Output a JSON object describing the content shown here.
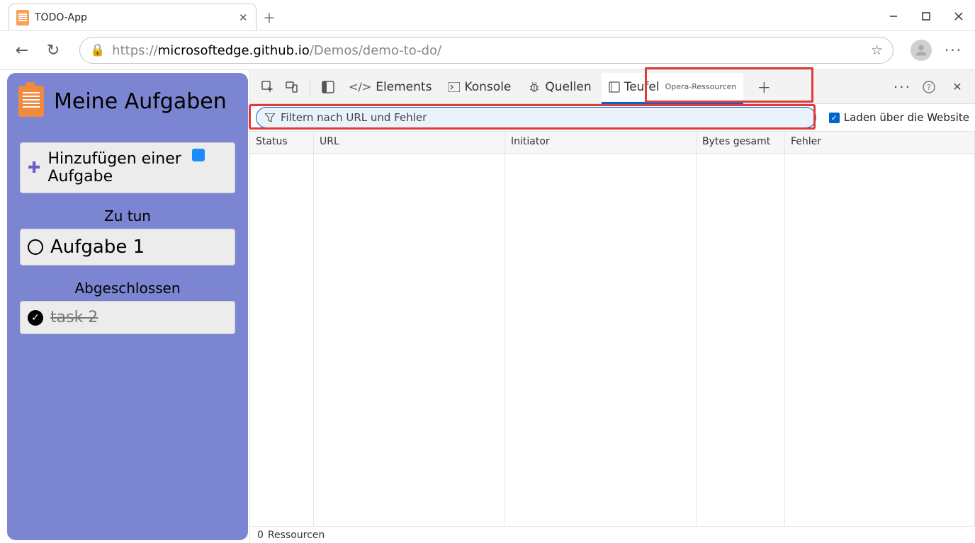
{
  "browser": {
    "tab_title": "TODO-App",
    "url_grey_prefix": "https://",
    "url_dark": "microsoftedge.github.io",
    "url_grey_suffix": "/Demos/demo-to-do/"
  },
  "app": {
    "title": "Meine Aufgaben",
    "add_task": "Hinzufügen einer Aufgabe",
    "todo_header": "Zu tun",
    "done_header": "Abgeschlossen",
    "todo_items": [
      "Aufgabe 1"
    ],
    "done_items": [
      "task 2"
    ]
  },
  "devtools": {
    "tabs": {
      "elements": "Elements",
      "konsole": "Konsole",
      "quellen": "Quellen",
      "teufel": "Teufel",
      "opera_sub": "Opera-Ressourcen"
    },
    "filter_placeholder": "Filtern nach URL und Fehler",
    "load_label": "Laden über die Website",
    "columns": {
      "status": "Status",
      "url": "URL",
      "initiator": "Initiator",
      "bytes": "Bytes gesamt",
      "error": "Fehler"
    },
    "status_count": "0",
    "status_label": "Ressourcen"
  }
}
